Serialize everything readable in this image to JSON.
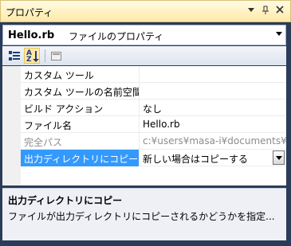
{
  "window": {
    "title": "プロパティ"
  },
  "title_buttons": {
    "dropdown": "▾",
    "pin": "ᵖ",
    "close": "✕"
  },
  "selector": {
    "name": "Hello.rb",
    "desc": "ファイルのプロパティ"
  },
  "toolbar": {
    "alpha_a": "A",
    "alpha_z": "Z"
  },
  "properties": [
    {
      "name": "カスタム ツール",
      "value": ""
    },
    {
      "name": "カスタム ツールの名前空間",
      "value": ""
    },
    {
      "name": "ビルド アクション",
      "value": "なし"
    },
    {
      "name": "ファイル名",
      "value": "Hello.rb"
    },
    {
      "name": "完全パス",
      "value": "c:¥users¥masa-i¥documents¥vi"
    },
    {
      "name": "出力ディレクトリにコピー",
      "value": "新しい場合はコピーする"
    }
  ],
  "description": {
    "title": "出力ディレクトリにコピー",
    "text": "ファイルが出力ディレクトリにコピーされるかどうかを指定..."
  },
  "colors": {
    "titlebar": "#ffe9a6",
    "selected": "#3399ff",
    "frame": "#2b3c59"
  }
}
